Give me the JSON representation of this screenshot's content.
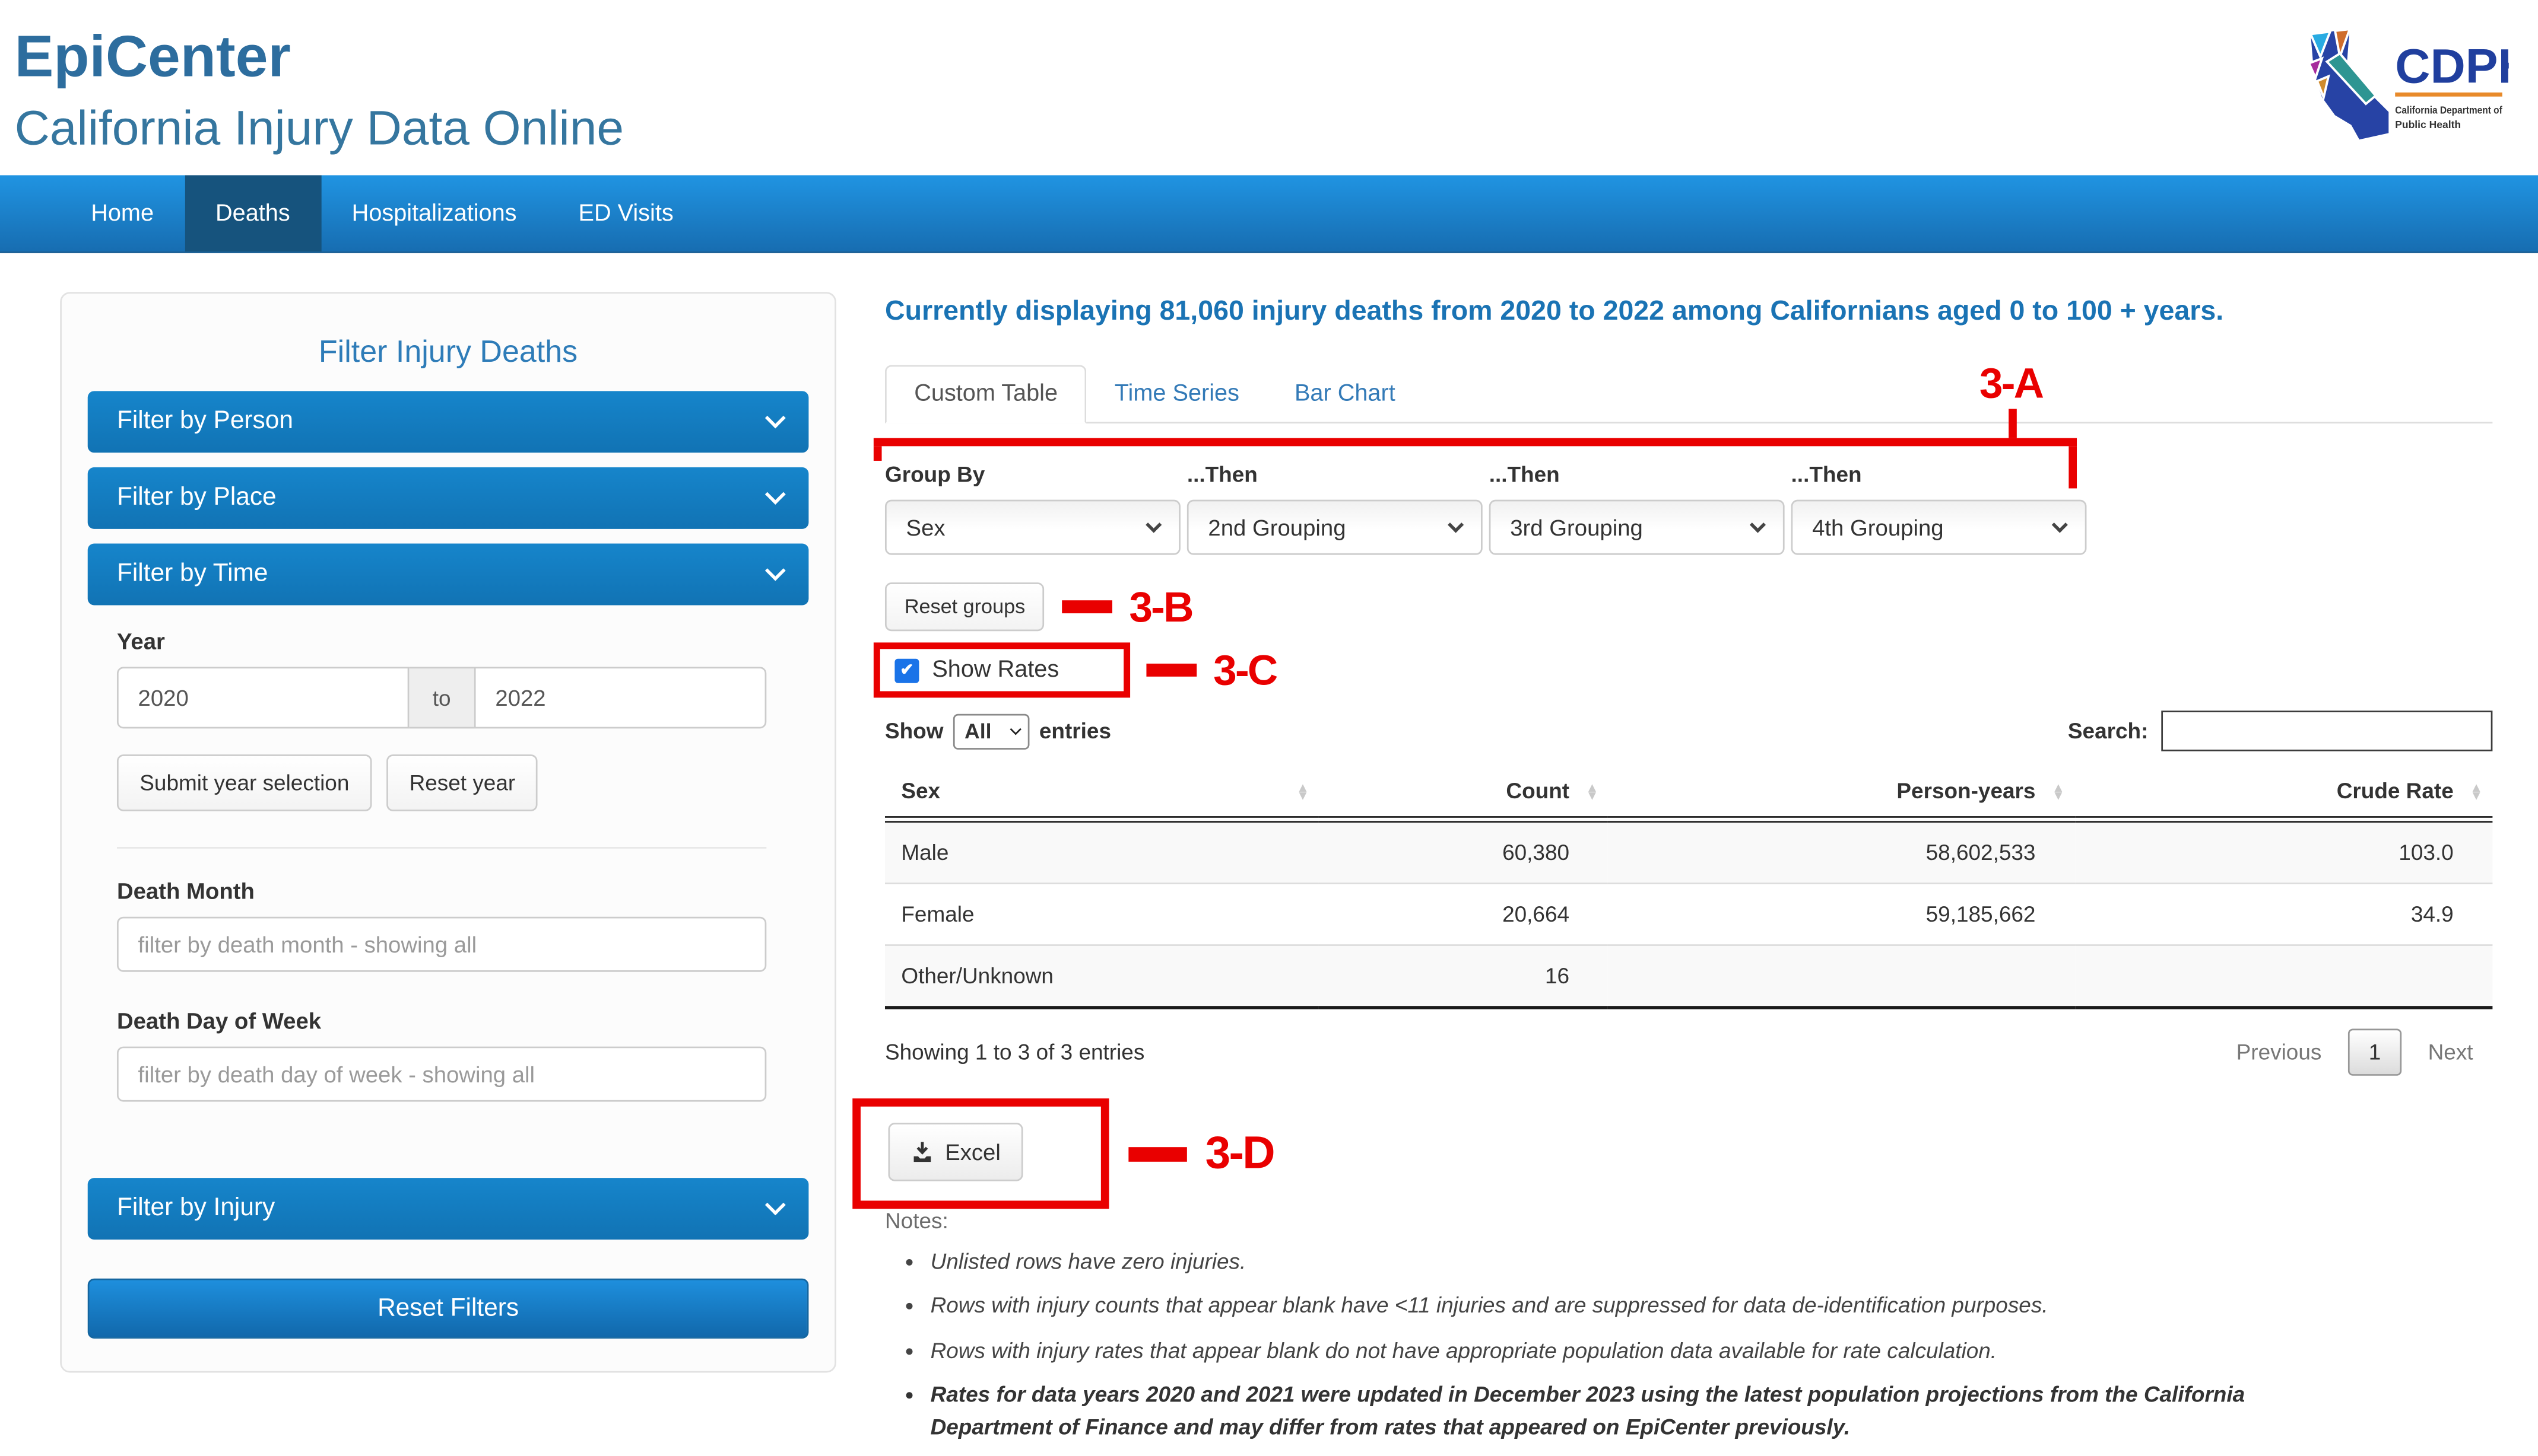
{
  "header": {
    "title": "EpiCenter",
    "subtitle": "California Injury Data Online",
    "logo": {
      "acronym": "CDPH",
      "org_line1": "California Department of",
      "org_line2": "Public Health"
    }
  },
  "nav": {
    "items": [
      {
        "label": "Home",
        "active": false
      },
      {
        "label": "Deaths",
        "active": true
      },
      {
        "label": "Hospitalizations",
        "active": false
      },
      {
        "label": "ED Visits",
        "active": false
      }
    ]
  },
  "sidebar": {
    "title": "Filter Injury Deaths",
    "accordions": [
      {
        "label": "Filter by Person"
      },
      {
        "label": "Filter by Place"
      },
      {
        "label": "Filter by Time"
      },
      {
        "label": "Filter by Injury"
      }
    ],
    "time_panel": {
      "year_label": "Year",
      "year_from": "2020",
      "to_word": "to",
      "year_to": "2022",
      "submit_button": "Submit year selection",
      "reset_button": "Reset year",
      "death_month_label": "Death Month",
      "death_month_placeholder": "filter by death month - showing all",
      "death_dow_label": "Death Day of Week",
      "death_dow_placeholder": "filter by death day of week - showing all"
    },
    "reset_filters_button": "Reset Filters"
  },
  "main": {
    "summary": "Currently displaying 81,060 injury deaths from 2020 to 2022 among Californians aged 0 to 100 + years.",
    "tabs": [
      {
        "label": "Custom Table",
        "active": true
      },
      {
        "label": "Time Series",
        "active": false
      },
      {
        "label": "Bar Chart",
        "active": false
      }
    ],
    "grouping": {
      "labels": [
        "Group By",
        "...Then",
        "...Then",
        "...Then"
      ],
      "selects": [
        "Sex",
        "2nd Grouping",
        "3rd Grouping",
        "4th Grouping"
      ],
      "reset_button": "Reset groups"
    },
    "show_rates": {
      "label": "Show Rates",
      "checked": true
    },
    "entries": {
      "show_label": "Show",
      "select_value": "All",
      "entries_label": "entries"
    },
    "search_label": "Search:",
    "search_value": "",
    "table": {
      "columns": [
        "Sex",
        "Count",
        "Person-years",
        "Crude Rate"
      ],
      "rows": [
        [
          "Male",
          "60,380",
          "58,602,533",
          "103.0"
        ],
        [
          "Female",
          "20,664",
          "59,185,662",
          "34.9"
        ],
        [
          "Other/Unknown",
          "16",
          "",
          ""
        ]
      ]
    },
    "footer": {
      "showing": "Showing 1 to 3 of 3 entries",
      "previous": "Previous",
      "page": "1",
      "next": "Next"
    },
    "excel_button": "Excel",
    "notes": {
      "title": "Notes:",
      "items": [
        "Unlisted rows have zero injuries.",
        "Rows with injury counts that appear blank have <11 injuries and are suppressed for data de-identification purposes.",
        "Rows with injury rates that appear blank do not have appropriate population data available for rate calculation.",
        "Rates for data years 2020 and 2021 were updated in December 2023 using the latest population projections from the California Department of Finance and may differ from rates that appeared on EpiCenter previously."
      ]
    }
  },
  "annotations": {
    "a": "3-A",
    "b": "3-B",
    "c": "3-C",
    "d": "3-D",
    "color": "#e90000"
  },
  "colors": {
    "heading_blue": "#2d6d9e",
    "navbar_top": "#2094e2",
    "navbar_bottom": "#176db1",
    "nav_active": "#16537d",
    "accordion_blue": "#1685cb",
    "summary_blue": "#1a73b4",
    "link_blue": "#337ab7",
    "annotation_red": "#e90000",
    "checkbox_blue": "#1a73e8"
  }
}
